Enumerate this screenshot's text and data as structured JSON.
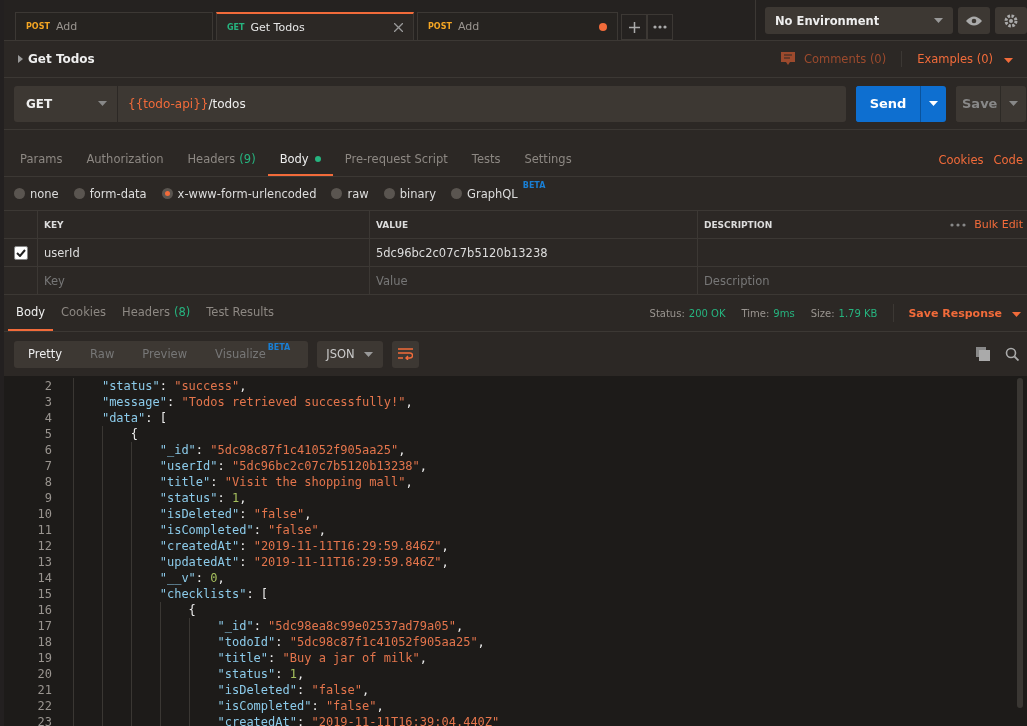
{
  "tabs": [
    {
      "method": "POST",
      "name": "Add",
      "selected": false,
      "modified": false
    },
    {
      "method": "GET",
      "name": "Get Todos",
      "selected": true,
      "modified": false
    },
    {
      "method": "POST",
      "name": "Add",
      "selected": false,
      "modified": true
    }
  ],
  "environment": "No Environment",
  "request": {
    "title": "Get Todos",
    "comments": "Comments (0)",
    "examples": "Examples (0)",
    "method": "GET",
    "url_variable": "{{todo-api}}",
    "url_path": "/todos",
    "send": "Send",
    "save": "Save"
  },
  "request_tabs": [
    {
      "label": "Params",
      "selected": false,
      "dot": false
    },
    {
      "label": "Authorization",
      "selected": false,
      "dot": false
    },
    {
      "label": "Headers",
      "count": "(9)",
      "selected": false,
      "dot": false
    },
    {
      "label": "Body",
      "selected": true,
      "dot": true
    },
    {
      "label": "Pre-request Script",
      "selected": false,
      "dot": false
    },
    {
      "label": "Tests",
      "selected": false,
      "dot": false
    },
    {
      "label": "Settings",
      "selected": false,
      "dot": false
    }
  ],
  "request_links": [
    "Cookies",
    "Code"
  ],
  "body_types": [
    {
      "label": "none",
      "selected": false
    },
    {
      "label": "form-data",
      "selected": false
    },
    {
      "label": "x-www-form-urlencoded",
      "selected": true
    },
    {
      "label": "raw",
      "selected": false
    },
    {
      "label": "binary",
      "selected": false
    },
    {
      "label": "GraphQL",
      "selected": false,
      "badge": "BETA"
    }
  ],
  "params_table": {
    "columns": [
      "KEY",
      "VALUE",
      "DESCRIPTION"
    ],
    "bulk_edit": "Bulk Edit",
    "rows": [
      {
        "key": "userId",
        "value": "5dc96bc2c07c7b5120b13238",
        "checked": true
      }
    ],
    "new_row": {
      "key": {
        "placeholder": "Key"
      },
      "value": {
        "placeholder": "Value"
      },
      "description": {
        "placeholder": "Description"
      }
    }
  },
  "response_tabs": [
    {
      "label": "Body",
      "selected": true
    },
    {
      "label": "Cookies",
      "selected": false
    },
    {
      "label": "Headers",
      "count": "(8)",
      "selected": false
    },
    {
      "label": "Test Results",
      "selected": false
    }
  ],
  "response_status": [
    {
      "label": "Status:",
      "value": "200 OK"
    },
    {
      "label": "Time:",
      "value": "9ms"
    },
    {
      "label": "Size:",
      "value": "1.79 KB"
    }
  ],
  "save_response": "Save Response",
  "view_modes": [
    {
      "label": "Pretty",
      "selected": true
    },
    {
      "label": "Raw",
      "selected": false
    },
    {
      "label": "Preview",
      "selected": false
    },
    {
      "label": "Visualize",
      "selected": false,
      "badge": "BETA"
    }
  ],
  "format": "JSON",
  "code_lines": [
    {
      "n": "2",
      "text": "    \"status\": \"success\","
    },
    {
      "n": "3",
      "text": "    \"message\": \"Todos retrieved successfully!\","
    },
    {
      "n": "4",
      "text": "    \"data\": ["
    },
    {
      "n": "5",
      "text": "        {"
    },
    {
      "n": "6",
      "text": "            \"_id\": \"5dc98c87f1c41052f905aa25\","
    },
    {
      "n": "7",
      "text": "            \"userId\": \"5dc96bc2c07c7b5120b13238\","
    },
    {
      "n": "8",
      "text": "            \"title\": \"Visit the shopping mall\","
    },
    {
      "n": "9",
      "text": "            \"status\": 1,"
    },
    {
      "n": "10",
      "text": "            \"isDeleted\": \"false\","
    },
    {
      "n": "11",
      "text": "            \"isCompleted\": \"false\","
    },
    {
      "n": "12",
      "text": "            \"createdAt\": \"2019-11-11T16:29:59.846Z\","
    },
    {
      "n": "13",
      "text": "            \"updatedAt\": \"2019-11-11T16:29:59.846Z\","
    },
    {
      "n": "14",
      "text": "            \"__v\": 0,"
    },
    {
      "n": "15",
      "text": "            \"checklists\": ["
    },
    {
      "n": "16",
      "text": "                {"
    },
    {
      "n": "17",
      "text": "                    \"_id\": \"5dc98ea8c99e02537ad79a05\","
    },
    {
      "n": "18",
      "text": "                    \"todoId\": \"5dc98c87f1c41052f905aa25\","
    },
    {
      "n": "19",
      "text": "                    \"title\": \"Buy a jar of milk\","
    },
    {
      "n": "20",
      "text": "                    \"status\": 1,"
    },
    {
      "n": "21",
      "text": "                    \"isDeleted\": \"false\","
    },
    {
      "n": "22",
      "text": "                    \"isCompleted\": \"false\","
    },
    {
      "n": "23",
      "text": "                    \"createdAt\": \"2019-11-11T16:39:04.440Z\""
    }
  ]
}
